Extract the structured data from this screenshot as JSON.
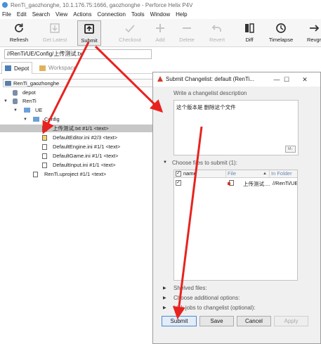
{
  "window": {
    "title": "RenTi_gaozhonghe,  10.1.176.75:1666,  gaozhonghe - Perforce Helix P4V"
  },
  "menubar": {
    "items": [
      "File",
      "Edit",
      "Search",
      "View",
      "Actions",
      "Connection",
      "Tools",
      "Window",
      "Help"
    ]
  },
  "toolbar": {
    "buttons": [
      {
        "label": "Refresh",
        "icon": "refresh-icon",
        "enabled": true
      },
      {
        "label": "Get Latest",
        "icon": "get-latest-icon",
        "enabled": false
      },
      {
        "label": "Submit",
        "icon": "submit-icon",
        "enabled": true
      },
      {
        "label": "Checkout",
        "icon": "checkout-icon",
        "enabled": false
      },
      {
        "label": "Add",
        "icon": "add-icon",
        "enabled": false
      },
      {
        "label": "Delete",
        "icon": "delete-icon",
        "enabled": false
      },
      {
        "label": "Revert",
        "icon": "revert-icon",
        "enabled": false
      },
      {
        "label": "Diff",
        "icon": "diff-icon",
        "enabled": true
      },
      {
        "label": "Timelapse",
        "icon": "timelapse-icon",
        "enabled": true
      },
      {
        "label": "Revgr",
        "icon": "revgraph-icon",
        "enabled": true
      }
    ]
  },
  "path_bar": {
    "value": "//RenTi/UE/Config/上传测试.tx"
  },
  "left_tabs": [
    {
      "label": "Depot",
      "icon": "depot-tab-icon",
      "active": true
    },
    {
      "label": "Workspace",
      "icon": "workspace-tab-icon",
      "active": false
    }
  ],
  "workspace_combo": {
    "value": "RenTi_gaozhonghe"
  },
  "tree": [
    {
      "label": "depot",
      "twisty": "",
      "icon": "depot-icon"
    },
    {
      "label": "RenTi",
      "twisty": "▼",
      "icon": "depot-icon"
    },
    {
      "label": "UE",
      "twisty": "▼",
      "icon": "folder-icon"
    },
    {
      "label": "Config",
      "twisty": "▼",
      "icon": "folder-icon"
    },
    {
      "label": "上传测试.txt #1/1 <text>",
      "twisty": "",
      "icon": "text-file-icon",
      "selected": true
    },
    {
      "label": "DefaultEditor.ini #2/3 <text>",
      "twisty": "",
      "icon": "ini-file-icon"
    },
    {
      "label": "DefaultEngine.ini #1/1 <text>",
      "twisty": "",
      "icon": "text-file-icon"
    },
    {
      "label": "DefaultGame.ini #1/1 <text>",
      "twisty": "",
      "icon": "text-file-icon"
    },
    {
      "label": "DefaultInput.ini #1/1 <text>",
      "twisty": "",
      "icon": "text-file-icon"
    },
    {
      "label": "RenTi.uproject #1/1 <text>",
      "twisty": "",
      "icon": "text-file-icon"
    }
  ],
  "dialog": {
    "title": "Submit Changelist: default (RenTi...",
    "description_label": "Write a changelist description",
    "description_value": "这个版本是 删除这个文件",
    "markdown_badge": "M↓",
    "files_section_label": "Choose files to submit (1):",
    "columns": [
      "name",
      "File",
      "In Folder"
    ],
    "files": [
      {
        "checked": true,
        "file": "上传测试....",
        "folder": "//RenTi/UE"
      }
    ],
    "collapsed_sections": [
      "Shelved files:",
      "Choose additional options:",
      "Link jobs to changelist (optional):"
    ],
    "buttons": {
      "submit": "Submit",
      "save": "Save",
      "cancel": "Cancel",
      "apply": "Apply"
    },
    "controls": {
      "minimize": "—",
      "maximize": "☐",
      "close": "✕"
    }
  },
  "colors": {
    "annotation_arrow": "#e8231f",
    "selection": "#c7c7c7",
    "default_button_border": "#4a8ad8",
    "dialog_warning_icon": "#d13b2a"
  }
}
